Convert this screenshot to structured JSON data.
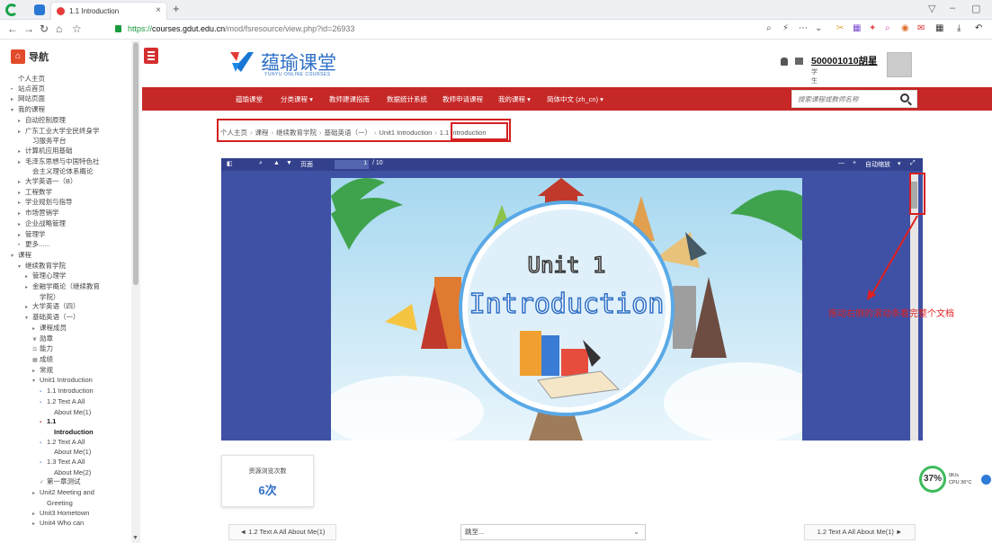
{
  "browser": {
    "tab_title": "1.1 Introduction",
    "tab_close": "×",
    "new_tab": "+",
    "url_scheme": "https://",
    "url_host": "courses.gdut.edu.cn",
    "url_path": "/mod/fsresource/view.php?id=26933",
    "window_min": "–",
    "window_restore": "▽"
  },
  "nav": {
    "heading": "导航",
    "tree": [
      {
        "label": "个人主页",
        "level": 0,
        "arrow": ""
      },
      {
        "label": "站点首页",
        "level": 0,
        "arrow": "•"
      },
      {
        "label": "网站页面",
        "level": 0,
        "arrow": "▸"
      },
      {
        "label": "我的课程",
        "level": 0,
        "arrow": "▾"
      },
      {
        "label": "自动控制原理",
        "level": 1,
        "arrow": "▸"
      },
      {
        "label": "广东工业大学全民终身学",
        "level": 1,
        "arrow": "▸"
      },
      {
        "label": "习服务平台",
        "level": 2,
        "arrow": ""
      },
      {
        "label": "计算机应用基础",
        "level": 1,
        "arrow": "▸"
      },
      {
        "label": "毛泽东思想与中国特色社",
        "level": 1,
        "arrow": "▸"
      },
      {
        "label": "会主义理论体系概论",
        "level": 2,
        "arrow": ""
      },
      {
        "label": "大学英语一（B）",
        "level": 1,
        "arrow": "▸"
      },
      {
        "label": "工程数学",
        "level": 1,
        "arrow": "▸"
      },
      {
        "label": "学业规划与指导",
        "level": 1,
        "arrow": "▸"
      },
      {
        "label": "市场营销学",
        "level": 1,
        "arrow": "▸"
      },
      {
        "label": "企业战略管理",
        "level": 1,
        "arrow": "▸"
      },
      {
        "label": "管理学",
        "level": 1,
        "arrow": "▸"
      },
      {
        "label": "更多......",
        "level": 1,
        "arrow": "•"
      },
      {
        "label": "课程",
        "level": 0,
        "arrow": "▾"
      },
      {
        "label": "继续教育学院",
        "level": 1,
        "arrow": "▾"
      },
      {
        "label": "管理心理学",
        "level": 2,
        "arrow": "▸"
      },
      {
        "label": "金融学概论（继续教育",
        "level": 2,
        "arrow": "▸"
      },
      {
        "label": "学院）",
        "level": 3,
        "arrow": ""
      },
      {
        "label": "大学英语（四）",
        "level": 2,
        "arrow": "▸"
      },
      {
        "label": "基础英语（一）",
        "level": 2,
        "arrow": "▾"
      },
      {
        "label": "课程成员",
        "level": 3,
        "arrow": "▸"
      },
      {
        "label": "勋章",
        "level": 3,
        "arrow": "❦"
      },
      {
        "label": "能力",
        "level": 3,
        "arrow": "⚖"
      },
      {
        "label": "成绩",
        "level": 3,
        "arrow": "▦"
      },
      {
        "label": "常规",
        "level": 3,
        "arrow": "▸"
      },
      {
        "label": "Unit1 Introduction",
        "level": 3,
        "arrow": "▾"
      },
      {
        "label": "1.1 Introduction",
        "level": 4,
        "arrow": "▪"
      },
      {
        "label": "1.2 Text A All",
        "level": 4,
        "arrow": "▪"
      },
      {
        "label": "About Me(1)",
        "level": 5,
        "arrow": ""
      },
      {
        "label": "1.1",
        "level": 4,
        "arrow": "▪",
        "current": true
      },
      {
        "label": "Introduction",
        "level": 5,
        "arrow": "",
        "current": true
      },
      {
        "label": "1.2 Text A All",
        "level": 4,
        "arrow": "▪"
      },
      {
        "label": "About Me(1)",
        "level": 5,
        "arrow": ""
      },
      {
        "label": "1.3 Text A All",
        "level": 4,
        "arrow": "▪"
      },
      {
        "label": "About Me(2)",
        "level": 5,
        "arrow": ""
      },
      {
        "label": "第一章测试",
        "level": 4,
        "arrow": "✓"
      },
      {
        "label": "Unit2 Meeting and",
        "level": 3,
        "arrow": "▸"
      },
      {
        "label": "Greeting",
        "level": 4,
        "arrow": ""
      },
      {
        "label": "Unit3 Hometown",
        "level": 3,
        "arrow": "▸"
      },
      {
        "label": "Unit4 Who can",
        "level": 3,
        "arrow": "▸"
      }
    ]
  },
  "header": {
    "logo_cn": "蕴瑜课堂",
    "logo_en": "YUNYU ONLINE COURSES",
    "user_name": "500001010胡星",
    "user_role": "学生"
  },
  "navbar": {
    "items": [
      "蕴瑜课堂",
      "分类课程 ▾",
      "教师建课指南",
      "数据统计系统",
      "教师申请课程",
      "我的课程 ▾",
      "简体中文 (zh_cn) ▾"
    ],
    "search_placeholder": "搜索课程或教师名称"
  },
  "breadcrumb": [
    "个人主页",
    "课程",
    "继续教育学院",
    "基础英语（一）",
    "Unit1 Introduction",
    "1.1 Introduction"
  ],
  "pdf": {
    "toolbar_page_label": "页面",
    "page_current": "1",
    "page_total": "/ 10",
    "zoom_label": "自动缩放",
    "slide_title": "Unit 1",
    "slide_subtitle": "Introduction"
  },
  "annotation": {
    "text": "拖动右侧的滚动条看完整个文档"
  },
  "stats": {
    "label": "资源浏览次数",
    "value": "6次"
  },
  "bottom": {
    "prev": "◄ 1.2 Text A All About Me(1)",
    "jump": "跳至...",
    "next": "1.2 Text A All About Me(1) ►"
  },
  "widget": {
    "percent": "37%",
    "speed": "0K/s",
    "cpu": "CPU 36°C"
  }
}
